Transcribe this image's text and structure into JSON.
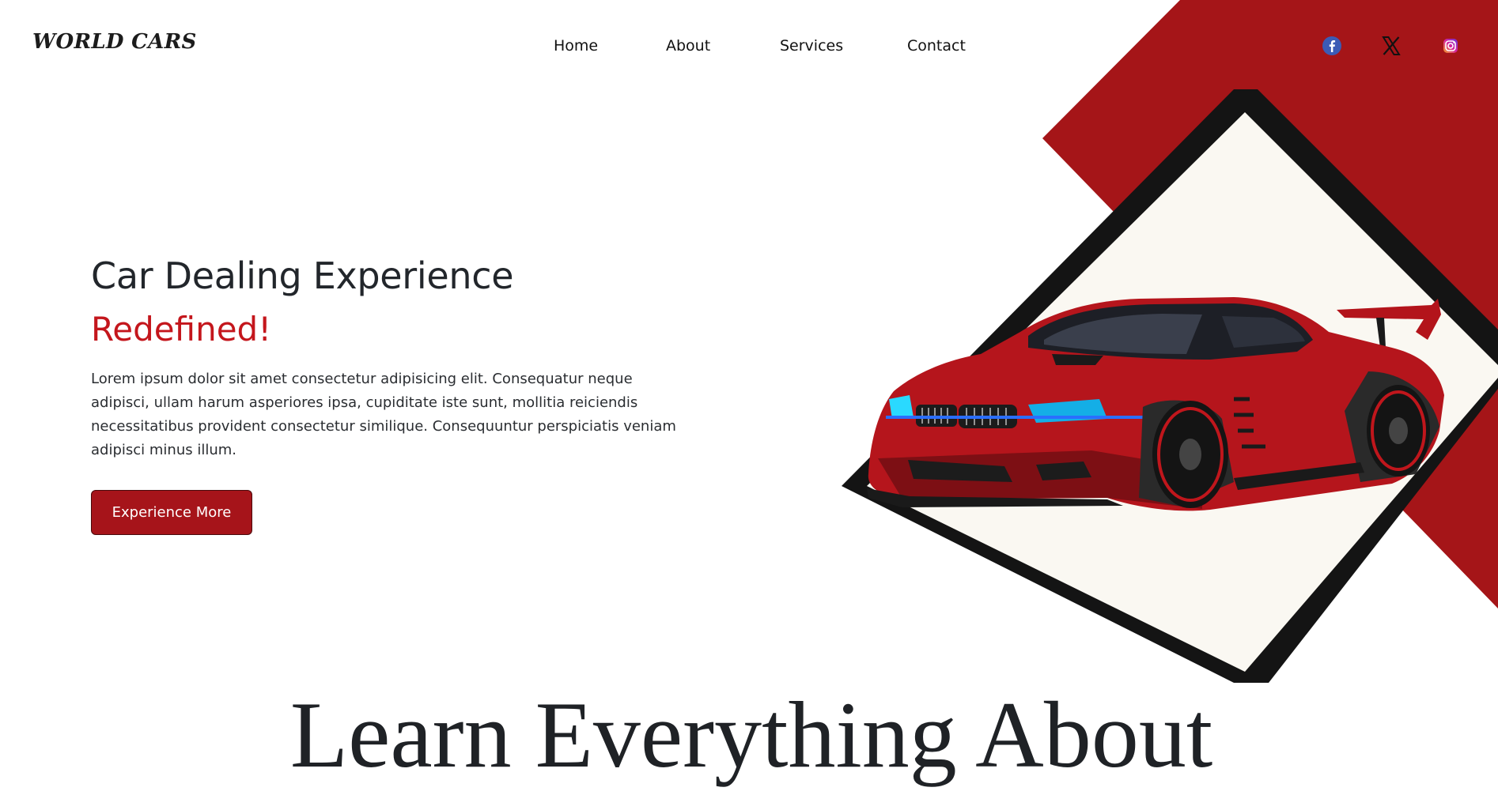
{
  "header": {
    "logo_text": "WORLD CARS",
    "nav": [
      {
        "label": "Home"
      },
      {
        "label": "About"
      },
      {
        "label": "Services"
      },
      {
        "label": "Contact"
      }
    ],
    "social": [
      {
        "icon": "facebook-icon",
        "color": "#3b5bb5"
      },
      {
        "icon": "x-icon",
        "color": "#111111"
      },
      {
        "icon": "instagram-icon",
        "color": "#c13584"
      }
    ]
  },
  "hero": {
    "title": "Car Dealing Experience",
    "accent_title": "Redefined!",
    "description": "Lorem ipsum dolor sit amet consectetur adipisicing elit. Consequatur neque adipisci, ullam harum asperiores ipsa, cupiditate iste sunt, mollitia reiciendis necessitatibus provident consectetur similique. Consequuntur perspiciatis veniam adipisci minus illum.",
    "cta_label": "Experience More"
  },
  "section": {
    "heading": "Learn Everything About"
  },
  "colors": {
    "accent": "#c4161c",
    "button": "#a6141a",
    "band": "#a51518",
    "frame": "#141414",
    "panel": "#faf8f2"
  }
}
